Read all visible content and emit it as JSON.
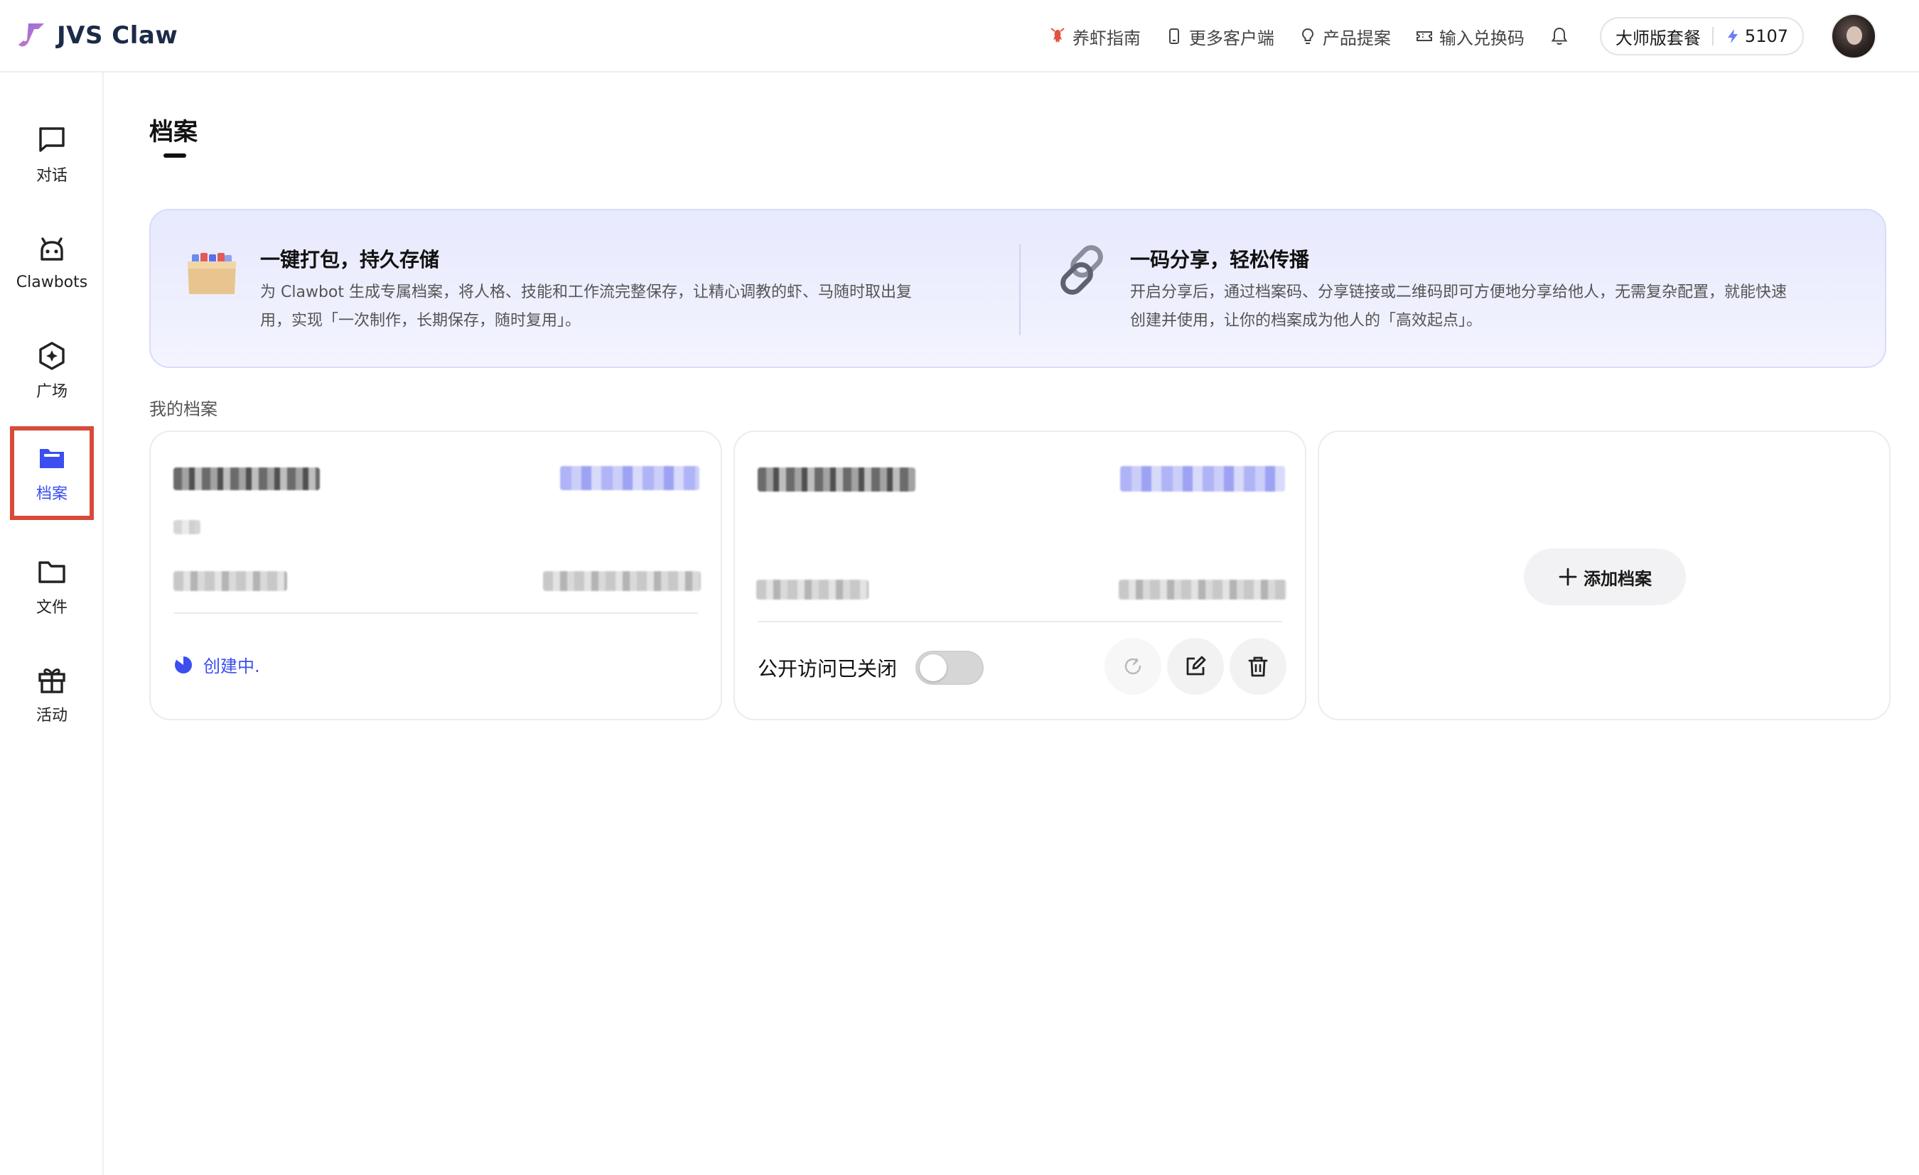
{
  "app": {
    "name": "JVS Claw"
  },
  "header": {
    "nav": [
      {
        "label": "养虾指南",
        "icon": "lobster-icon"
      },
      {
        "label": "更多客户端",
        "icon": "phone-icon"
      },
      {
        "label": "产品提案",
        "icon": "lightbulb-icon"
      },
      {
        "label": "输入兑换码",
        "icon": "ticket-icon"
      }
    ],
    "plan": {
      "name": "大师版套餐",
      "credits": "5107"
    }
  },
  "sidebar": {
    "items": [
      {
        "label": "对话",
        "icon": "chat-icon"
      },
      {
        "label": "Clawbots",
        "icon": "robot-icon"
      },
      {
        "label": "广场",
        "icon": "plaza-icon"
      },
      {
        "label": "档案",
        "icon": "archive-icon",
        "active": true
      },
      {
        "label": "文件",
        "icon": "folder-icon"
      },
      {
        "label": "活动",
        "icon": "gift-icon"
      }
    ]
  },
  "page": {
    "title": "档案",
    "section_label": "我的档案"
  },
  "banner": {
    "left": {
      "title": "一键打包，持久存储",
      "desc_line1": "为 Clawbot 生成专属档案，将人格、技能和工作流完整保存，让精心调教的虾、马随时取出复",
      "desc_line2": "用，实现「一次制作，长期保存，随时复用」。"
    },
    "right": {
      "title": "一码分享，轻松传播",
      "desc_line1": "开启分享后，通过档案码、分享链接或二维码即可方便地分享给他人，无需复杂配置，就能快速",
      "desc_line2": "创建并使用，让你的档案成为他人的「高效起点」。"
    }
  },
  "cards": {
    "card1": {
      "status": "创建中."
    },
    "card2": {
      "public_access_label": "公开访问已关闭",
      "public_access_on": false
    },
    "add_label": "添加档案"
  },
  "colors": {
    "accent": "#3b4ef0",
    "highlight_border": "#d84a3a"
  }
}
